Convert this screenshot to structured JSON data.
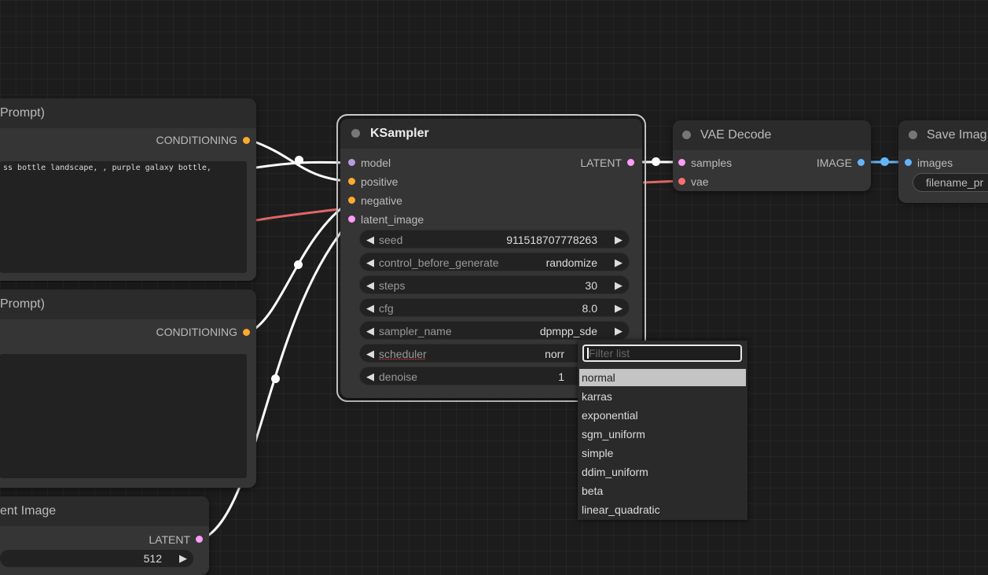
{
  "colors": {
    "background": "#1c1c1c",
    "node_body": "#353535",
    "node_title": "#2b2b2b",
    "conditioning": "#ffa931",
    "latent": "#ff9cf9",
    "model": "#b39ddb",
    "vae": "#ff6e6e",
    "image": "#64b5f6"
  },
  "nodes": {
    "positive_prompt": {
      "title": "Prompt)",
      "output": "CONDITIONING",
      "text": "ss bottle landscape, , purple galaxy bottle,"
    },
    "negative_prompt": {
      "title": "Prompt)",
      "output": "CONDITIONING",
      "text": ""
    },
    "latent_image": {
      "title": "ent Image",
      "output": "LATENT",
      "width_value": "512"
    },
    "ksampler": {
      "title": "KSampler",
      "inputs": [
        "model",
        "positive",
        "negative",
        "latent_image"
      ],
      "output": "LATENT",
      "widgets": [
        {
          "label": "seed",
          "value": "911518707778263"
        },
        {
          "label": "control_before_generate",
          "value": "randomize"
        },
        {
          "label": "steps",
          "value": "30"
        },
        {
          "label": "cfg",
          "value": "8.0"
        },
        {
          "label": "sampler_name",
          "value": "dpmpp_sde"
        },
        {
          "label": "scheduler",
          "value": "norr"
        },
        {
          "label": "denoise",
          "value": "1"
        }
      ]
    },
    "vae_decode": {
      "title": "VAE Decode",
      "inputs": [
        "samples",
        "vae"
      ],
      "output": "IMAGE"
    },
    "save_image": {
      "title": "Save Imag",
      "inputs": [
        "images"
      ],
      "filename_label": "filename_pr"
    }
  },
  "dropdown": {
    "filter_placeholder": "Filter list",
    "items": [
      "normal",
      "karras",
      "exponential",
      "sgm_uniform",
      "simple",
      "ddim_uniform",
      "beta",
      "linear_quadratic"
    ],
    "selected": "normal"
  }
}
